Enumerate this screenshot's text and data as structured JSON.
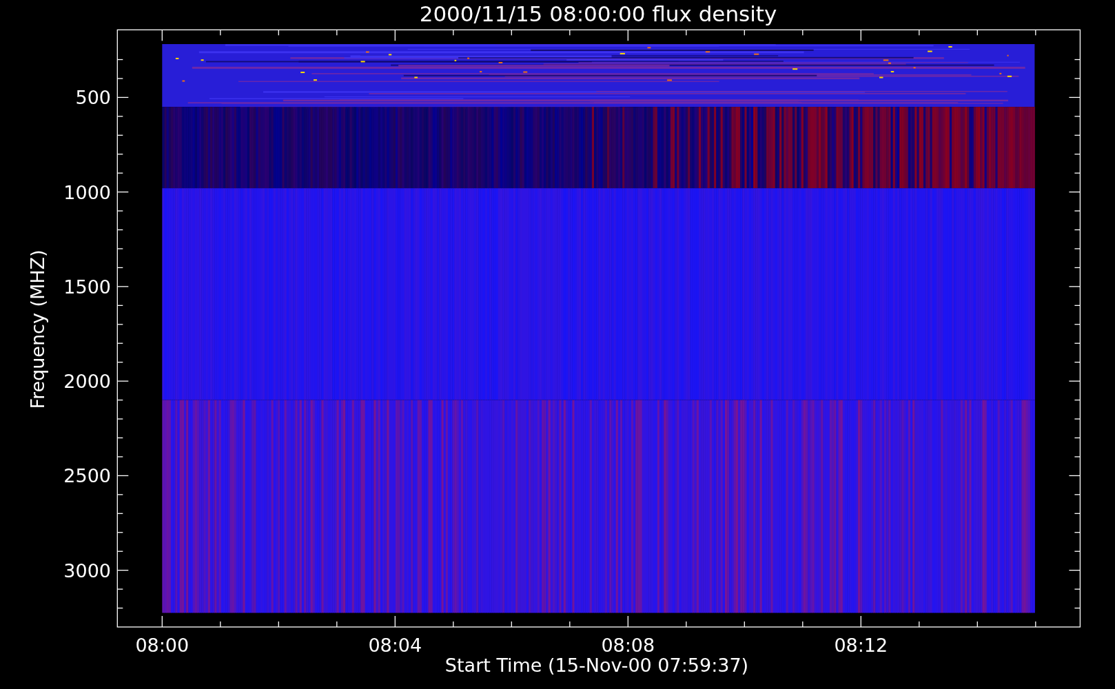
{
  "title": "2000/11/15 08:00:00 flux density",
  "y_axis": {
    "label": "Frequency (MHZ)",
    "tick_labels": [
      "500",
      "1000",
      "1500",
      "2000",
      "2500",
      "3000"
    ]
  },
  "x_axis": {
    "label": "Start Time (15-Nov-00 07:59:37)",
    "tick_labels": [
      "08:00",
      "08:04",
      "08:08",
      "08:12"
    ]
  }
}
